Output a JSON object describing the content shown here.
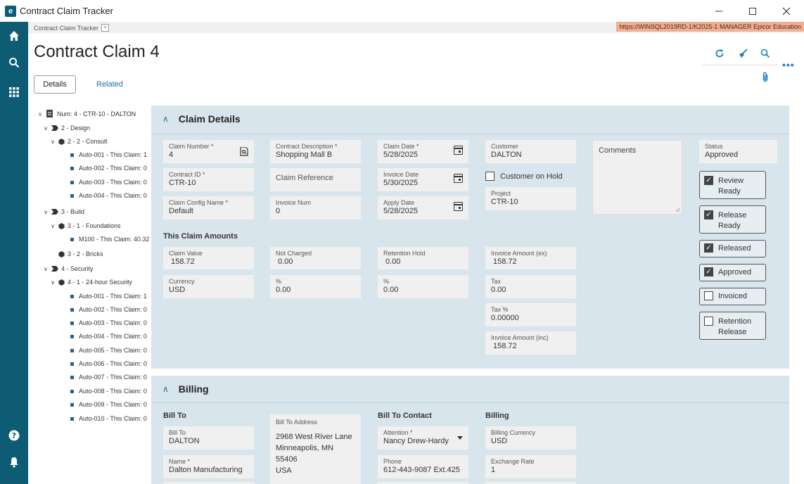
{
  "window": {
    "title": "Contract Claim Tracker",
    "app_icon": "epicor-logo",
    "controls": [
      "minimize",
      "maximize",
      "close"
    ]
  },
  "sidebar": {
    "items": [
      "home-icon",
      "search-icon",
      "apps-grid-icon",
      "help-icon",
      "bell-icon"
    ]
  },
  "breadcrumb": {
    "label": "Contract Claim Tracker",
    "arrow": ">"
  },
  "environment": {
    "text": "https://WINSQL2019RD-1/K2025-1   MANAGER   Epicor Education",
    "color": "#f4ad8e"
  },
  "page": {
    "title": "Contract Claim 4"
  },
  "toolbar": {
    "icons": [
      "refresh-icon",
      "broom-clear-icon",
      "search-icon",
      "more-icon",
      "attachment-icon"
    ],
    "more": "•••"
  },
  "tabs": {
    "details": "Details",
    "related": "Related"
  },
  "tree": {
    "root": "Num: 4 - CTR-10 - DALTON",
    "nodes": [
      "2 - Design",
      "2 - 2 - Consult",
      "Auto-001 - This Claim: 1",
      "Auto-002 - This Claim: 0",
      "Auto-003 - This Claim: 0",
      "Auto-004 - This Claim: 0",
      "3 - Build",
      "3 - 1 - Foundations",
      "M100 - This Claim: 40.32",
      "3 - 2 - Bricks",
      "4 - Security",
      "4 - 1 - 24-hour Security",
      "Auto-001 - This Claim: 1",
      "Auto-002 - This Claim: 0",
      "Auto-003 - This Claim: 0",
      "Auto-004 - This Claim: 0",
      "Auto-005 - This Claim: 0",
      "Auto-006 - This Claim: 0",
      "Auto-007 - This Claim: 0",
      "Auto-008 - This Claim: 0",
      "Auto-009 - This Claim: 0",
      "Auto-010 - This Claim: 0"
    ]
  },
  "claim_details": {
    "heading": "Claim Details",
    "claim_number": {
      "label": "Claim Number *",
      "value": "4"
    },
    "contract_id": {
      "label": "Contract ID *",
      "value": "CTR-10"
    },
    "claim_config": {
      "label": "Claim Config Name *",
      "value": "Default"
    },
    "contract_desc": {
      "label": "Contract Description *",
      "value": "Shopping Mall B"
    },
    "claim_reference": {
      "label": "Claim Reference"
    },
    "invoice_num": {
      "label": "Invoice Num",
      "value": "0"
    },
    "claim_date": {
      "label": "Claim Date *",
      "value": "5/28/2025"
    },
    "invoice_date": {
      "label": "Invoice Date",
      "value": "5/30/2025"
    },
    "apply_date": {
      "label": "Apply Date",
      "value": "5/28/2025"
    },
    "customer": {
      "label": "Customer",
      "value": "DALTON"
    },
    "customer_on_hold": "Customer on Hold",
    "project": {
      "label": "Project",
      "value": "CTR-10"
    },
    "comments": "Comments",
    "status": {
      "label": "Status",
      "value": "Approved"
    },
    "amounts_heading": "This Claim Amounts",
    "claim_value": {
      "label": "Claim Value",
      "value": "158.72"
    },
    "currency": {
      "label": "Currency",
      "value": "USD"
    },
    "not_charged": {
      "label": "Not Charged",
      "value": "0.00"
    },
    "pct1": {
      "label": "%",
      "value": "0.00"
    },
    "retention_hold": {
      "label": "Retention Hold",
      "value": "0.00"
    },
    "pct2": {
      "label": "%",
      "value": "0.00"
    },
    "invoice_amount_ex": {
      "label": "Invoice Amount (ex)",
      "value": "158.72"
    },
    "tax": {
      "label": "Tax",
      "value": "0.00"
    },
    "tax_pct": {
      "label": "Tax %",
      "value": "0.00000"
    },
    "invoice_amount_inc": {
      "label": "Invoice Amount (inc)",
      "value": "158.72"
    },
    "checks": [
      {
        "label1": "Review",
        "label2": "Ready",
        "checked": true
      },
      {
        "label1": "Release",
        "label2": "Ready",
        "checked": true
      },
      {
        "label1": "Released",
        "label2": "",
        "checked": true
      },
      {
        "label1": "Approved",
        "label2": "",
        "checked": true
      },
      {
        "label1": "Invoiced",
        "label2": "",
        "checked": false
      },
      {
        "label1": "Retention",
        "label2": "Release",
        "checked": false
      }
    ]
  },
  "billing": {
    "heading": "Billing",
    "bill_to_heading": "Bill To",
    "bill_to": {
      "label": "Bill To",
      "value": "DALTON"
    },
    "name": {
      "label": "Name *",
      "value": "Dalton Manufacturing"
    },
    "address": {
      "label": "Bill To Address",
      "line1": "2968 West River Lane",
      "line2": "Minneapolis, MN  55406",
      "line3": "USA"
    },
    "contact_heading": "Bill To Contact",
    "attention": {
      "label": "Attention *",
      "value": "Nancy Drew-Hardy"
    },
    "phone": {
      "label": "Phone",
      "value": "612-443-9087 Ext.425"
    },
    "billing_heading": "Billing",
    "billing_currency": {
      "label": "Billing Currency",
      "value": "USD"
    },
    "exchange_rate": {
      "label": "Exchange Rate",
      "value": "1"
    }
  }
}
